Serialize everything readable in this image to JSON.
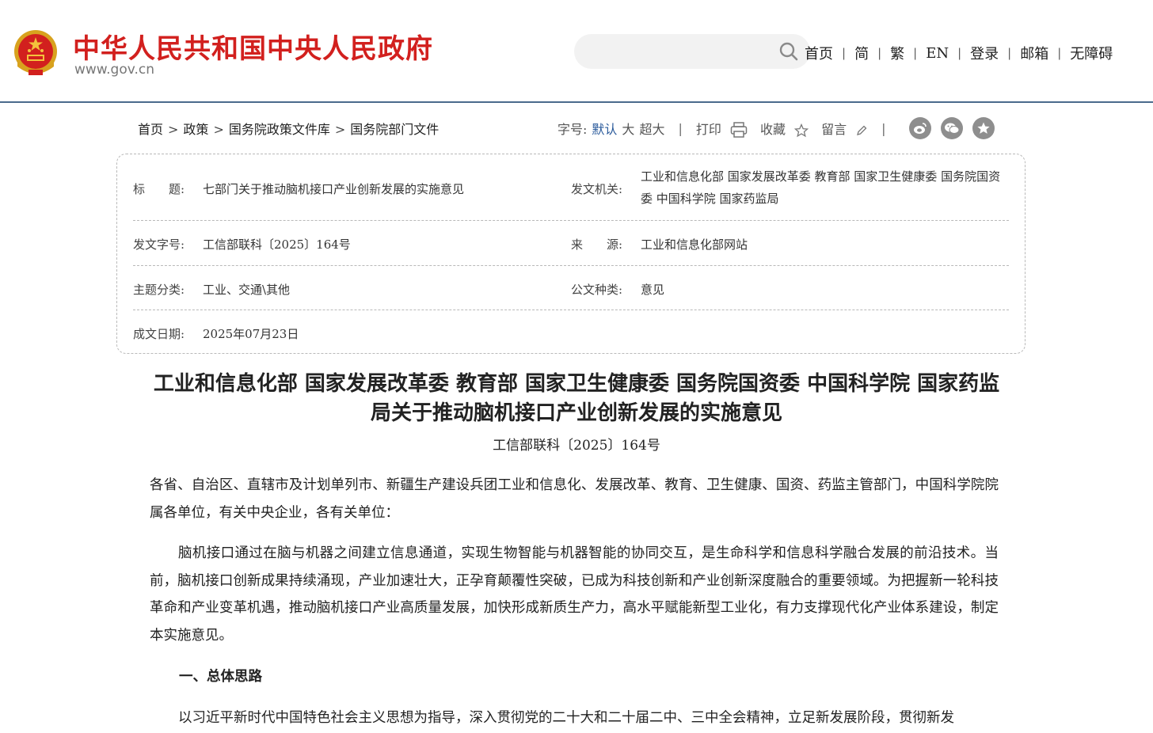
{
  "header": {
    "site_name": "中华人民共和国中央人民政府",
    "site_url": "www.gov.cn",
    "search_placeholder": "",
    "nav": [
      "首页",
      "简",
      "繁",
      "EN",
      "登录",
      "邮箱",
      "无障碍"
    ]
  },
  "breadcrumb": [
    "首页",
    "政策",
    "国务院政策文件库",
    "国务院部门文件"
  ],
  "tools": {
    "font_label": "字号:",
    "font_default": "默认",
    "font_large": "大",
    "font_xlarge": "超大",
    "print": "打印",
    "favorite": "收藏",
    "comment": "留言",
    "share_icons": [
      "weibo-icon",
      "wechat-icon",
      "favorite-star-icon"
    ]
  },
  "info": {
    "title_label": "标　　题:",
    "title_value": "七部门关于推动脑机接口产业创新发展的实施意见",
    "issuer_label": "发文机关:",
    "issuer_value": "工业和信息化部 国家发展改革委 教育部 国家卫生健康委 国务院国资委 中国科学院 国家药监局",
    "docno_label": "发文字号:",
    "docno_value": "工信部联科〔2025〕164号",
    "source_label": "来　　源:",
    "source_value": "工业和信息化部网站",
    "topic_label": "主题分类:",
    "topic_value": "工业、交通\\其他",
    "type_label": "公文种类:",
    "type_value": "意见",
    "date_label": "成文日期:",
    "date_value": "2025年07月23日"
  },
  "article": {
    "title": "工业和信息化部 国家发展改革委 教育部 国家卫生健康委 国务院国资委 中国科学院 国家药监局关于推动脑机接口产业创新发展的实施意见",
    "doc_number": "工信部联科〔2025〕164号",
    "salutation": "各省、自治区、直辖市及计划单列市、新疆生产建设兵团工业和信息化、发展改革、教育、卫生健康、国资、药监主管部门，中国科学院院属各单位，有关中央企业，各有关单位：",
    "para1": "脑机接口通过在脑与机器之间建立信息通道，实现生物智能与机器智能的协同交互，是生命科学和信息科学融合发展的前沿技术。当前，脑机接口创新成果持续涌现，产业加速壮大，正孕育颠覆性突破，已成为科技创新和产业创新深度融合的重要领域。为把握新一轮科技革命和产业变革机遇，推动脑机接口产业高质量发展，加快形成新质生产力，高水平赋能新型工业化，有力支撑现代化产业体系建设，制定本实施意见。",
    "section1": "一、总体思路",
    "para2": "以习近平新时代中国特色社会主义思想为指导，深入贯彻党的二十大和二十届二中、三中全会精神，立足新发展阶段，贯彻新发"
  },
  "colors": {
    "brand_red": "#d2201e",
    "header_rule": "#4a6a8c",
    "link_active": "#2a5a9b"
  }
}
